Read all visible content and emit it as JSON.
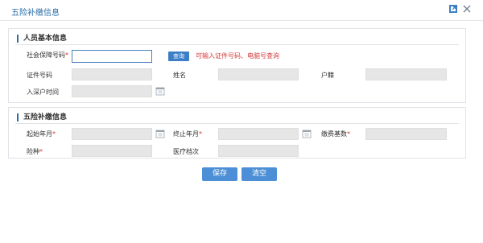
{
  "window": {
    "title": "五险补缴信息",
    "maximize_icon": "maximize-icon",
    "close_icon": "close-icon"
  },
  "personal": {
    "section_title": "人员基本信息",
    "ssn_label": "社会保障号码",
    "ssn_value": "",
    "query_label": "查询",
    "hint": "可输入证件号码、电脑号查询",
    "id_label": "证件号码",
    "id_value": "",
    "name_label": "姓名",
    "name_value": "",
    "household_label": "户籍",
    "household_value": "",
    "entry_date_label": "入深户时间",
    "entry_date_value": ""
  },
  "payment": {
    "section_title": "五险补缴信息",
    "start_label": "起始年月",
    "start_value": "",
    "end_label": "终止年月",
    "end_value": "",
    "base_label": "缴费基数",
    "base_value": "",
    "insurance_label": "险种",
    "insurance_value": "",
    "medical_label": "医疗档次",
    "medical_value": ""
  },
  "buttons": {
    "save": "保存",
    "clear": "清空"
  },
  "colors": {
    "accent": "#2a6ea8",
    "button": "#4c8fd6",
    "required": "#e03030",
    "hint": "#d23c3c"
  }
}
